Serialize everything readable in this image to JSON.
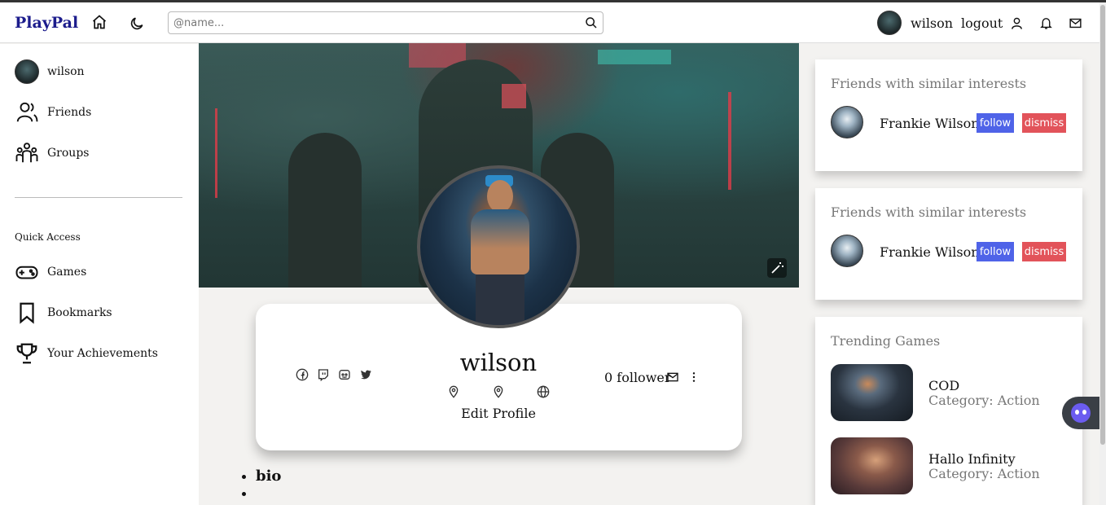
{
  "brand": "PlayPal",
  "search": {
    "placeholder": "@name..."
  },
  "nav": {
    "username": "wilson",
    "logout": "logout"
  },
  "sidebar": {
    "profile_label": "wilson",
    "items": [
      {
        "label": "Friends"
      },
      {
        "label": "Groups"
      }
    ],
    "quick_access_title": "Quick Access",
    "quick_items": [
      {
        "label": "Games"
      },
      {
        "label": "Bookmarks"
      },
      {
        "label": "Your Achievements"
      }
    ]
  },
  "profile": {
    "name": "wilson",
    "edit_label": "Edit Profile",
    "followers": "0 follower"
  },
  "bio": {
    "label": "bio",
    "empty_item": ""
  },
  "suggestions": [
    {
      "title": "Friends with similar interests",
      "name": "Frankie Wilson",
      "follow": "follow",
      "dismiss": "dismiss"
    },
    {
      "title": "Friends with similar interests",
      "name": "Frankie Wilson",
      "follow": "follow",
      "dismiss": "dismiss"
    }
  ],
  "trending": {
    "title": "Trending Games",
    "games": [
      {
        "name": "COD",
        "category": "Category: Action"
      },
      {
        "name": "Hallo Infinity",
        "category": "Category: Action"
      }
    ]
  },
  "colors": {
    "brand": "#1c1c8c",
    "follow": "#4f63e8",
    "dismiss": "#e2535a"
  }
}
